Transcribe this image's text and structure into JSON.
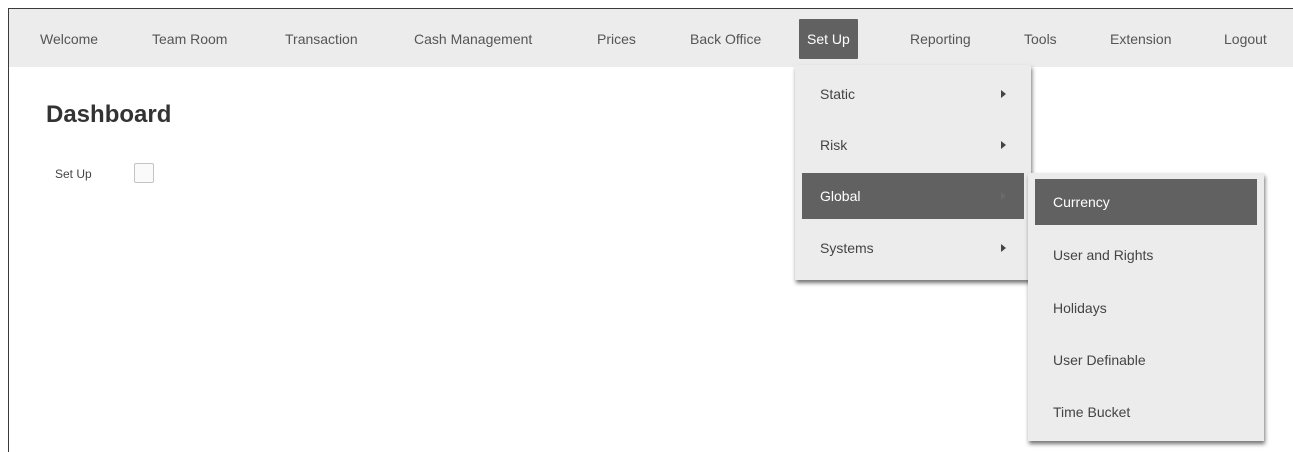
{
  "nav": {
    "items": [
      {
        "label": "Welcome"
      },
      {
        "label": "Team Room"
      },
      {
        "label": "Transaction"
      },
      {
        "label": "Cash Management"
      },
      {
        "label": "Prices"
      },
      {
        "label": "Back Office"
      },
      {
        "label": "Set Up"
      },
      {
        "label": "Reporting"
      },
      {
        "label": "Tools"
      },
      {
        "label": "Extension"
      },
      {
        "label": "Logout"
      }
    ],
    "active": "Set Up"
  },
  "main": {
    "title": "Dashboard",
    "setup_label": "Set Up"
  },
  "setup_menu": {
    "items": [
      {
        "label": "Static"
      },
      {
        "label": "Risk"
      },
      {
        "label": "Global"
      },
      {
        "label": "Systems"
      }
    ],
    "highlighted": "Global"
  },
  "global_submenu": {
    "items": [
      {
        "label": "Currency"
      },
      {
        "label": "User and Rights"
      },
      {
        "label": "Holidays"
      },
      {
        "label": "User Definable"
      },
      {
        "label": "Time Bucket"
      }
    ],
    "highlighted": "Currency"
  },
  "colors": {
    "nav_bg": "#ececec",
    "active_bg": "#616161",
    "active_text": "#ffffff"
  }
}
